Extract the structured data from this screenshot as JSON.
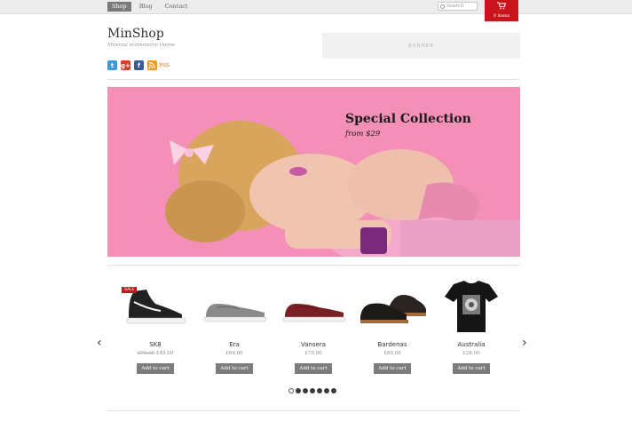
{
  "nav": {
    "items": [
      "Shop",
      "Blog",
      "Contact"
    ],
    "active_index": 0
  },
  "search": {
    "placeholder": "Search"
  },
  "cart": {
    "items_label": "0 items",
    "color": "#c9141c"
  },
  "header": {
    "logo": "MinShop",
    "tagline": "Minimal ecommerce theme",
    "banner_label": "BANNER",
    "social": [
      {
        "icon": "twitter-icon",
        "glyph": "t"
      },
      {
        "icon": "google-plus-icon",
        "glyph": "g+"
      },
      {
        "icon": "facebook-icon",
        "glyph": "f"
      },
      {
        "icon": "rss-icon",
        "glyph": ""
      }
    ],
    "rss_label": "RSS"
  },
  "hero": {
    "title": "Special Collection",
    "subtitle": "from $29"
  },
  "products": [
    {
      "name": "SK8",
      "old_price": "£79.00",
      "price": "£49.00",
      "sale": "SALE",
      "button": "Add to cart",
      "image": "black-high-top-sneaker"
    },
    {
      "name": "Era",
      "old_price": "",
      "price": "£69.00",
      "sale": "",
      "button": "Add to cart",
      "image": "grey-low-sneaker"
    },
    {
      "name": "Vansera",
      "old_price": "",
      "price": "£79.00",
      "sale": "",
      "button": "Add to cart",
      "image": "burgundy-low-sneaker"
    },
    {
      "name": "Bardenas",
      "old_price": "",
      "price": "£69.00",
      "sale": "",
      "button": "Add to cart",
      "image": "black-leather-shoes"
    },
    {
      "name": "Australia",
      "old_price": "",
      "price": "£28.00",
      "sale": "",
      "button": "Add to cart",
      "image": "black-graphic-tshirt"
    }
  ],
  "carousel": {
    "prev": "‹",
    "next": "›",
    "dot_count": 7,
    "active_dot": 0
  }
}
